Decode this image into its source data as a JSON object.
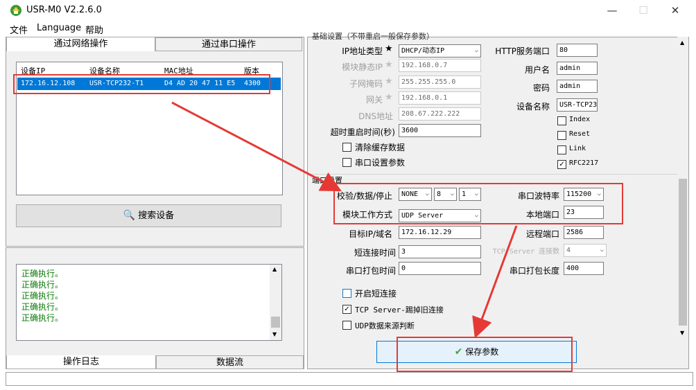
{
  "window": {
    "title": "USR-M0 V2.2.6.0",
    "minimize": "—",
    "maximize": "☐",
    "close": "✕"
  },
  "menu": [
    "文件",
    "Language",
    "帮助"
  ],
  "left_tabs": {
    "network": "通过网络操作",
    "serial": "通过串口操作"
  },
  "device_list": {
    "columns": [
      "设备IP",
      "设备名称",
      "MAC地址",
      "版本"
    ],
    "rows": [
      {
        "ip": "172.16.12.108",
        "name": "USR-TCP232-T1",
        "mac": "D4 AD 20 47 11 E5",
        "version": "4300"
      }
    ]
  },
  "search_button": "搜索设备",
  "log": {
    "lines": [
      "正确执行。",
      "正确执行。",
      "正确执行。",
      "正确执行。",
      "正确执行。"
    ]
  },
  "bottom_tabs": {
    "log": "操作日志",
    "data": "数据流"
  },
  "basic": {
    "section": "基础设置（不带重启一般保存参数）",
    "ip_type_label": "IP地址类型",
    "ip_type": "DHCP/动态IP",
    "static_ip_label": "模块静态IP",
    "static_ip": "192.168.0.7",
    "mask_label": "子网掩码",
    "mask": "255.255.255.0",
    "gateway_label": "网关",
    "gateway": "192.168.0.1",
    "dns_label": "DNS地址",
    "dns": "208.67.222.222",
    "timeout_label": "超时重启时间(秒)",
    "timeout": "3600",
    "clear_cache": "清除缓存数据",
    "serial_params": "串口设置参数",
    "http_port_label": "HTTP服务端口",
    "http_port": "80",
    "username_label": "用户名",
    "username": "admin",
    "password_label": "密码",
    "password": "admin",
    "device_name_label": "设备名称",
    "device_name": "USR-TCP23",
    "chk_index": "Index",
    "chk_reset": "Reset",
    "chk_link": "Link",
    "chk_rfc": "RFC2217"
  },
  "port": {
    "section": "端口设置",
    "parity_label": "校验/数据/停止",
    "parity": "NONE",
    "databits": "8",
    "stopbits": "1",
    "baud_label": "串口波特率",
    "baud": "115200",
    "mode_label": "模块工作方式",
    "mode": "UDP Server",
    "local_port_label": "本地端口",
    "local_port": "23",
    "target_label": "目标IP/域名",
    "target": "172.16.12.29",
    "remote_port_label": "远程端口",
    "remote_port": "2586",
    "short_time_label": "短连接时间",
    "short_time": "3",
    "tcp_conn_label": "TCP Server 连接数",
    "tcp_conn": "4",
    "pack_time_label": "串口打包时间",
    "pack_time": "0",
    "pack_len_label": "串口打包长度",
    "pack_len": "400",
    "opt_short": "开启短连接",
    "opt_kick": "TCP Server-踢掉旧连接",
    "opt_udp": "UDP数据来源判断"
  },
  "save_button": "保存参数",
  "colors": {
    "selection": "#0078d7",
    "annotation": "#e53935",
    "log_text": "#0a7a0a"
  }
}
